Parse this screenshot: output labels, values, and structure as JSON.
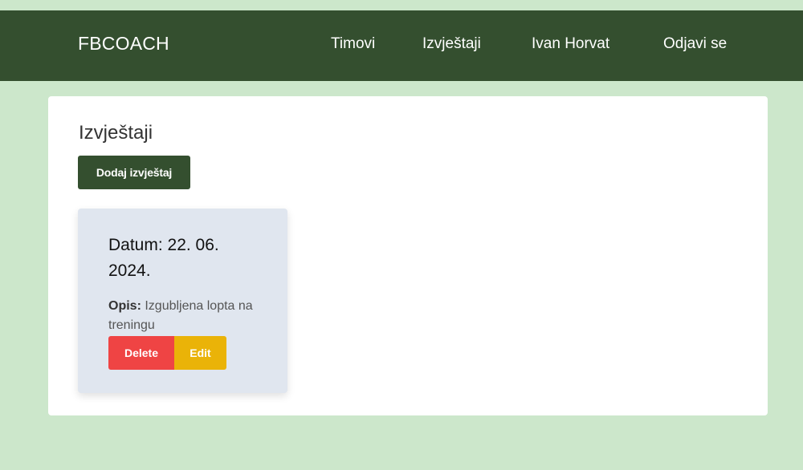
{
  "navbar": {
    "brand": "FBCOACH",
    "links": {
      "teams": "Timovi",
      "reports": "Izvještaji",
      "user": "Ivan Horvat",
      "logout": "Odjavi se"
    }
  },
  "main": {
    "title": "Izvještaji",
    "add_button_label": "Dodaj izvještaj",
    "reports": [
      {
        "date_text": "Datum: 22. 06. 2024.",
        "description_label": "Opis:",
        "description": "Izgubljena lopta na treningu",
        "delete_label": "Delete",
        "edit_label": "Edit"
      }
    ]
  },
  "colors": {
    "page_background": "#cce7cb",
    "navbar": "#344f2f",
    "card": "#e0e6ef",
    "delete": "#ef4444",
    "edit": "#eab308"
  }
}
